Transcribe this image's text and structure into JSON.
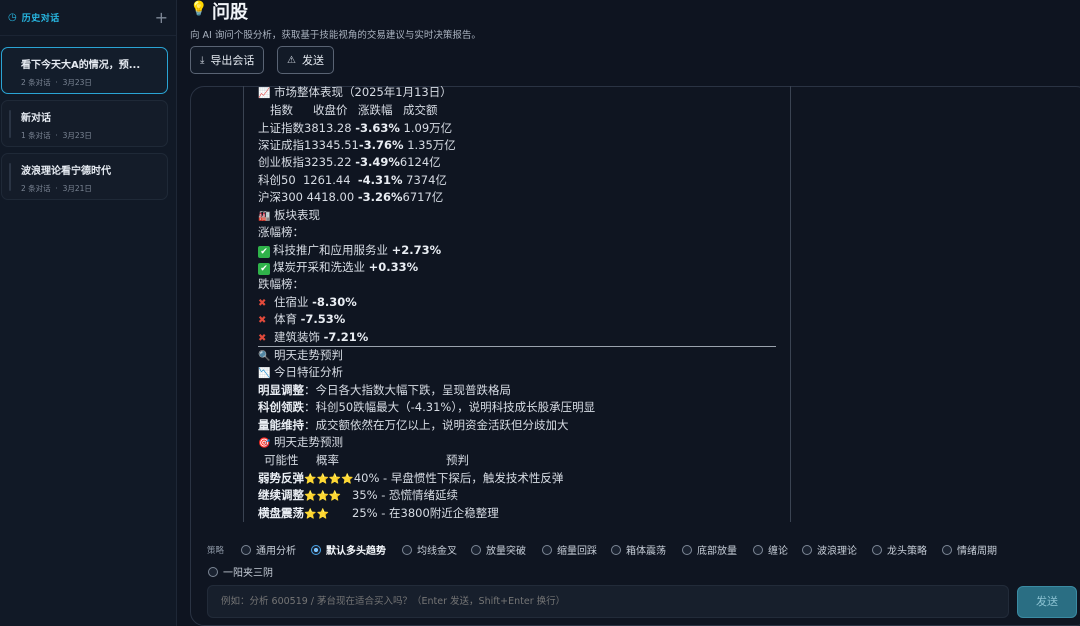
{
  "sidebar": {
    "title": "历史对话",
    "conversations": [
      {
        "title": "看下今天大A的情况，预...",
        "count": "2 条对话",
        "date": "3月23日"
      },
      {
        "title": "新对话",
        "count": "1 条对话",
        "date": "3月23日"
      },
      {
        "title": "波浪理论看宁德时代",
        "count": "2 条对话",
        "date": "3月21日"
      }
    ]
  },
  "header": {
    "title": "问股",
    "subtitle": "向 AI 询问个股分析，获取基于技能视角的交易建议与实时决策报告。",
    "export_label": "导出会话",
    "send_label": "发送"
  },
  "message": {
    "market_heading": "市场整体表现（2025年1月13日）",
    "table_headers": [
      "指数",
      "收盘价",
      "涨跌幅",
      "成交额"
    ],
    "indices": [
      {
        "name": "上证指数",
        "close": "3813.28",
        "change": "-3.63%",
        "volume": "1.09万亿"
      },
      {
        "name": "深证成指",
        "close": "13345.51",
        "change": "-3.76%",
        "volume": "1.35万亿"
      },
      {
        "name": "创业板指",
        "close": "3235.22",
        "change": "-3.49%",
        "volume": "6124亿"
      },
      {
        "name": "科创50",
        "close": "1261.44",
        "change": "-4.31%",
        "volume": "7374亿"
      },
      {
        "name": "沪深300",
        "close": "4418.00",
        "change": "-3.26%",
        "volume": "6717亿"
      }
    ],
    "sector_heading": "板块表现",
    "gainers_label": "涨幅榜：",
    "gainers": [
      {
        "name": "科技推广和应用服务业",
        "change": "+2.73%"
      },
      {
        "name": "煤炭开采和洗选业",
        "change": "+0.33%"
      }
    ],
    "losers_label": "跌幅榜：",
    "losers": [
      {
        "name": "住宿业",
        "change": "-8.30%"
      },
      {
        "name": "体育",
        "change": "-7.53%"
      },
      {
        "name": "建筑装饰",
        "change": "-7.21%"
      }
    ],
    "forecast_heading": "明天走势预判",
    "analysis_heading": "今日特征分析",
    "features": [
      {
        "label": "明显调整",
        "text": "：今日各大指数大幅下跌，呈现普跌格局"
      },
      {
        "label": "科创领跌",
        "text": "：科创50跌幅最大（-4.31%），说明科技成长股承压明显"
      },
      {
        "label": "量能维持",
        "text": "：成交额依然在万亿以上，说明资金活跃但分歧加大"
      }
    ],
    "prediction_heading": "明天走势预测",
    "prediction_headers": [
      "可能性",
      "概率",
      "预判"
    ],
    "predictions": [
      {
        "name": "弱势反弹",
        "stars": "⭐⭐⭐⭐",
        "text": "40% - 早盘惯性下探后，触发技术性反弹"
      },
      {
        "name": "继续调整",
        "stars": "⭐⭐⭐",
        "text": "35% - 恐慌情绪延续"
      },
      {
        "name": "横盘震荡",
        "stars": "⭐⭐",
        "text": "25% - 在3800附近企稳整理"
      }
    ]
  },
  "strategy": {
    "label": "策略",
    "options": [
      "通用分析",
      "默认多头趋势",
      "均线金叉",
      "放量突破",
      "缩量回踩",
      "箱体震荡",
      "底部放量",
      "缠论",
      "波浪理论",
      "龙头策略",
      "情绪周期",
      "一阳夹三阴"
    ],
    "selected": "默认多头趋势"
  },
  "composer": {
    "placeholder": "例如：分析 600519 / 茅台现在适合买入吗？（Enter 发送，Shift+Enter 换行）",
    "send_label": "发送"
  },
  "colors": {
    "accent": "#27b8e3",
    "loss": "#e24a3b",
    "gain": "#2fb34a",
    "send_button": "#2a6e83"
  }
}
